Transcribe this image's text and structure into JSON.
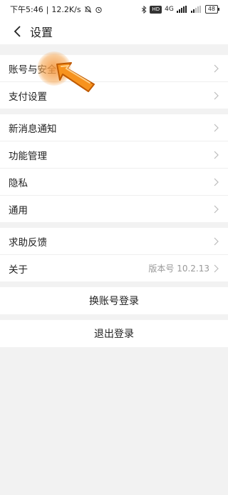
{
  "status": {
    "time": "下午5:46",
    "speed": "12.2K/s",
    "hd": "HD",
    "net": "4G",
    "battery": "48"
  },
  "header": {
    "title": "设置"
  },
  "sections": [
    {
      "items": [
        {
          "label": "账号与安全"
        },
        {
          "label": "支付设置"
        }
      ]
    },
    {
      "items": [
        {
          "label": "新消息通知"
        },
        {
          "label": "功能管理"
        },
        {
          "label": "隐私"
        },
        {
          "label": "通用"
        }
      ]
    },
    {
      "items": [
        {
          "label": "求助反馈"
        },
        {
          "label": "关于",
          "value": "版本号 10.2.13"
        }
      ]
    }
  ],
  "actions": {
    "switch_account": "换账号登录",
    "logout": "退出登录"
  },
  "colors": {
    "accent": "#f7931e",
    "background": "#f2f2f2"
  }
}
